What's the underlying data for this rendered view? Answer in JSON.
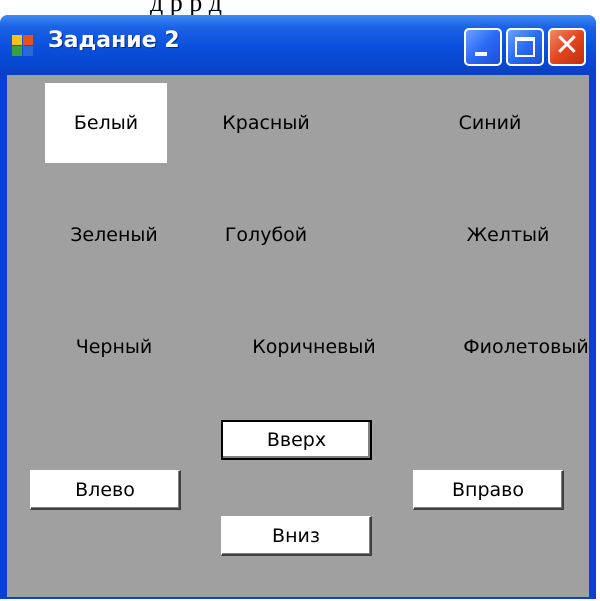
{
  "page_top_text": "д   р   р д",
  "window": {
    "title": "Задание 2",
    "app_icon": "winforms-app-icon",
    "controls": {
      "minimize": "minimize-icon",
      "maximize": "maximize-icon",
      "close": "close-icon"
    }
  },
  "colors": [
    {
      "label": "Белый",
      "selected": true
    },
    {
      "label": "Красный",
      "selected": false
    },
    {
      "label": "Синий",
      "selected": false
    },
    {
      "label": "Зеленый",
      "selected": false
    },
    {
      "label": "Голубой",
      "selected": false
    },
    {
      "label": "Желтый",
      "selected": false
    },
    {
      "label": "Черный",
      "selected": false
    },
    {
      "label": "Коричневый",
      "selected": false
    },
    {
      "label": "Фиолетовый",
      "selected": false
    }
  ],
  "buttons": {
    "up": "Вверх",
    "left": "Влево",
    "right": "Вправо",
    "down": "Вниз"
  },
  "theme": {
    "client_bg": "#a0a0a0",
    "selected_bg": "#ffffff",
    "titlebar_blue": "#0a4fdb"
  }
}
